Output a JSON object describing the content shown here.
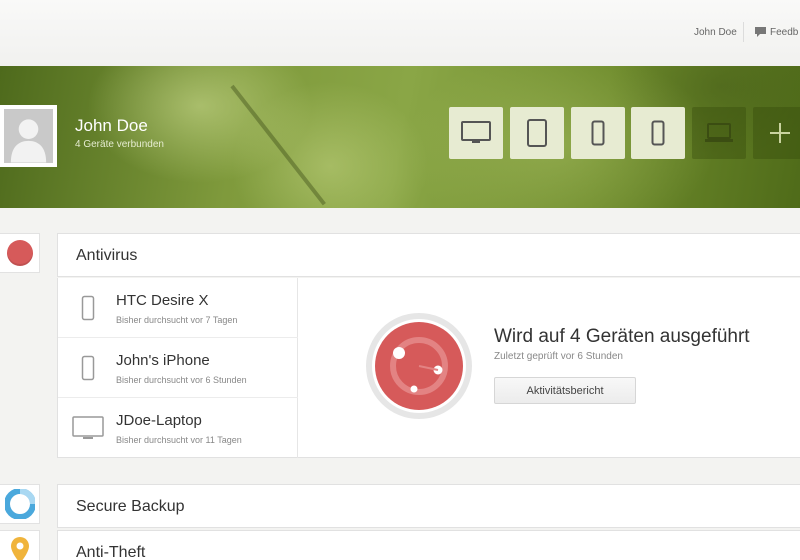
{
  "topbar": {
    "user_name": "John Doe",
    "feedback_label": "Feedb"
  },
  "profile": {
    "name": "John Doe",
    "subtitle": "4 Geräte verbunden"
  },
  "device_buttons": [
    {
      "icon": "monitor-icon",
      "state": "active"
    },
    {
      "icon": "tablet-icon",
      "state": "active"
    },
    {
      "icon": "phone-icon",
      "state": "active"
    },
    {
      "icon": "phone-icon",
      "state": "active"
    },
    {
      "icon": "laptop-icon",
      "state": "inactive"
    },
    {
      "icon": "plus-icon",
      "state": "inactive"
    }
  ],
  "sections": {
    "antivirus": {
      "title": "Antivirus",
      "status_color": "#d65a5a",
      "devices": [
        {
          "name": "HTC Desire X",
          "last_scan": "Bisher durchsucht vor 7 Tagen",
          "icon": "phone-icon"
        },
        {
          "name": "John's iPhone",
          "last_scan": "Bisher durchsucht vor 6 Stunden",
          "icon": "phone-icon"
        },
        {
          "name": "JDoe-Laptop",
          "last_scan": "Bisher durchsucht vor 11 Tagen",
          "icon": "monitor-icon"
        }
      ],
      "status_title": "Wird auf 4 Geräten ausgeführt",
      "status_sub": "Zuletzt geprüft vor 6 Stunden",
      "report_button": "Aktivitätsbericht"
    },
    "backup": {
      "title": "Secure Backup",
      "status_color": "#4aa8dc"
    },
    "antitheft": {
      "title": "Anti-Theft",
      "status_color": "#f0b43c"
    }
  },
  "colors": {
    "banner_green": "#7f9a3c",
    "device_button_bg": "#e7ebd2",
    "antivirus_red": "#d65a5a"
  }
}
